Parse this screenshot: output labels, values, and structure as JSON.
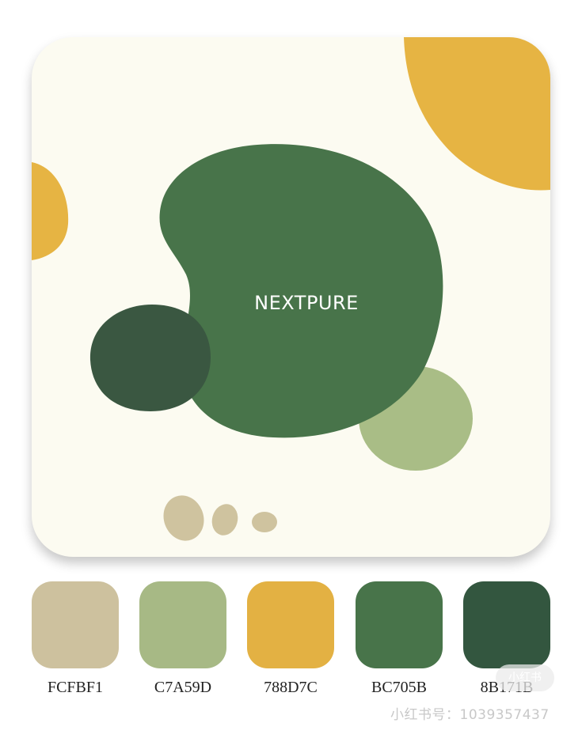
{
  "poster": {
    "brand": "NEXTPURE"
  },
  "palette": [
    {
      "label": "FCFBF1",
      "color": "#cdc19e"
    },
    {
      "label": "C7A59D",
      "color": "#a7b985"
    },
    {
      "label": "788D7C",
      "color": "#e3b143"
    },
    {
      "label": "BC705B",
      "color": "#48744a"
    },
    {
      "label": "8B171B",
      "color": "#33563f"
    }
  ],
  "colors": {
    "background": "#fcfbf1",
    "yellow": "#e6b443",
    "green": "#48744a",
    "dark_green": "#3a5741",
    "light_green": "#a9bd86",
    "beige": "#cfc39f"
  },
  "watermark": {
    "text": "小红书号：1039357437",
    "badge": "小红书"
  }
}
